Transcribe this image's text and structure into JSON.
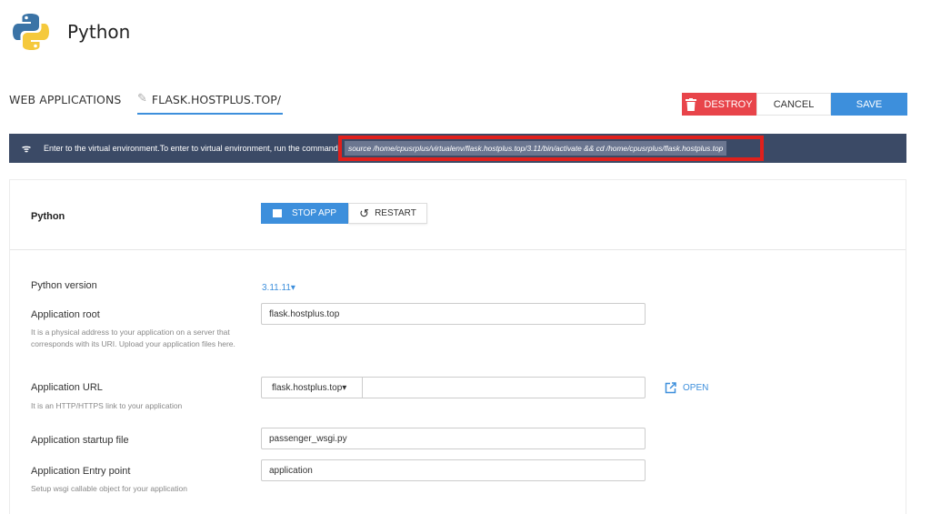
{
  "header": {
    "title": "Python",
    "logo_icon": "python-logo-icon"
  },
  "breadcrumb": {
    "parent": "WEB APPLICATIONS",
    "current": "FLASK.HOSTPLUS.TOP/",
    "edit_icon": "pencil-icon"
  },
  "actions": {
    "destroy": "DESTROY",
    "cancel": "CANCEL",
    "save": "SAVE"
  },
  "banner": {
    "icon": "rss-icon",
    "text": "Enter to the virtual environment.To enter to virtual environment, run the command",
    "command": "source /home/cpusrplus/virtualenv/flask.hostplus.top/3.11/bin/activate && cd /home/cpusrplus/flask.hostplus.top"
  },
  "app_card": {
    "title": "Python",
    "stop_label": "STOP APP",
    "restart_label": "RESTART"
  },
  "form": {
    "python_version": {
      "label": "Python version",
      "value": "3.11.11"
    },
    "app_root": {
      "label": "Application root",
      "help": "It is a physical address to your application on a server that corresponds with its URI. Upload your application files here.",
      "value": "flask.hostplus.top"
    },
    "app_url": {
      "label": "Application URL",
      "help": "It is an HTTP/HTTPS link to your application",
      "domain": "flask.hostplus.top",
      "path": "",
      "open_label": "OPEN"
    },
    "startup_file": {
      "label": "Application startup file",
      "value": "passenger_wsgi.py"
    },
    "entry_point": {
      "label": "Application Entry point",
      "help": "Setup wsgi callable object for your application",
      "value": "application"
    }
  },
  "colors": {
    "accent": "#3d8fdc",
    "danger": "#e8444a",
    "banner_bg": "#3b4a66",
    "highlight_border": "#e0201c"
  }
}
